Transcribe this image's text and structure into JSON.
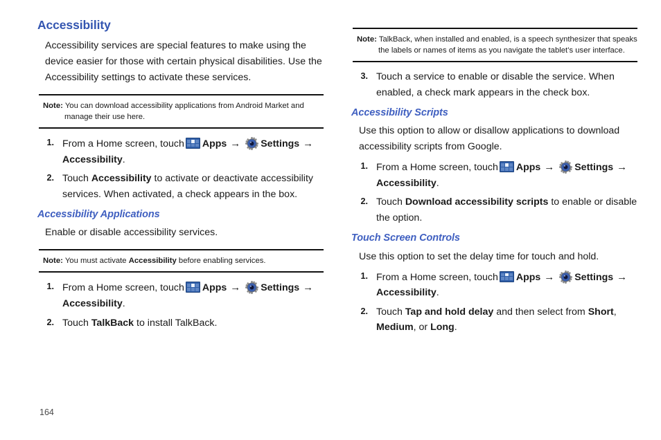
{
  "page": {
    "number": "164"
  },
  "icons": {
    "apps": "apps-grid-icon",
    "settings": "settings-gear-icon",
    "arrow": "→"
  },
  "left_column": {
    "heading": "Accessibility",
    "intro": "Accessibility services are special features to make using the device easier for those with certain physical disabilities. Use the Accessibility settings to activate these services.",
    "note1": {
      "label": "Note:",
      "text": "You can download accessibility applications from Android Market and manage their use here."
    },
    "steps1": [
      {
        "num": "1.",
        "pre": "From a Home screen, touch",
        "apps_label": "Apps",
        "settings_label": "Settings",
        "tail_arrow": "→",
        "tail": "Accessibility",
        "tail_period": "."
      },
      {
        "num": "2.",
        "a": "Touch ",
        "b": "Accessibility",
        "c": " to activate or deactivate accessibility services. When activated, a check appears in the box."
      }
    ],
    "subheading": "Accessibility Applications",
    "sub_intro": "Enable or disable accessibility services.",
    "note2": {
      "label": "Note:",
      "a": "You must activate ",
      "b": "Accessibility",
      "c": " before enabling services."
    },
    "steps2": [
      {
        "num": "1.",
        "pre": "From a Home screen, touch",
        "apps_label": "Apps",
        "settings_label": "Settings",
        "tail_arrow": "→",
        "tail": "Accessibility",
        "tail_period": "."
      },
      {
        "num": "2.",
        "a": "Touch ",
        "b": "TalkBack",
        "c": " to install TalkBack."
      }
    ]
  },
  "right_column": {
    "note1": {
      "label": "Note:",
      "text": "TalkBack, when installed and enabled, is a speech synthesizer that speaks the labels or names of items as you navigate the tablet’s user interface."
    },
    "step3": {
      "num": "3.",
      "text": "Touch a service to enable or disable the service. When enabled, a check mark appears in the check box."
    },
    "section_scripts": {
      "heading": "Accessibility Scripts",
      "intro": "Use this option to allow or disallow applications to download accessibility scripts from Google.",
      "steps": [
        {
          "num": "1.",
          "pre": "From a Home screen, touch",
          "apps_label": "Apps",
          "settings_label": "Settings",
          "tail_arrow": "→",
          "tail": "Accessibility",
          "tail_period": "."
        },
        {
          "num": "2.",
          "a": "Touch ",
          "b": "Download accessibility scripts",
          "c": " to enable or disable the option."
        }
      ]
    },
    "section_touch": {
      "heading": "Touch Screen Controls",
      "intro": "Use this option to set the delay time for touch and hold.",
      "steps": [
        {
          "num": "1.",
          "pre": "From a Home screen, touch",
          "apps_label": "Apps",
          "settings_label": "Settings",
          "tail_arrow": "→",
          "tail": "Accessibility",
          "tail_period": "."
        },
        {
          "num": "2.",
          "a": "Touch ",
          "b": "Tap and hold delay",
          "c": " and then select from ",
          "d": "Short",
          "e": ", ",
          "f": "Medium",
          "g": ", or ",
          "h": "Long",
          "i": "."
        }
      ]
    }
  },
  "colors": {
    "heading_blue": "#3355b0",
    "subheading_blue": "#3f5fc0",
    "rule_black": "#111111",
    "apps_icon_blue": "#2f5ea8",
    "gear_blue": "#3b5fae"
  }
}
